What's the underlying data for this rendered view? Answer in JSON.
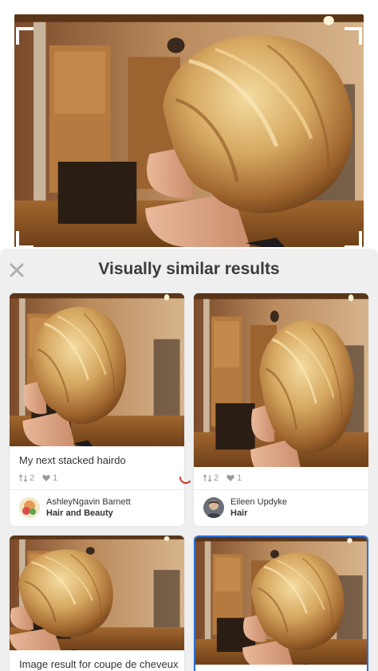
{
  "sheet": {
    "title": "Visually similar results",
    "close_icon": "close-icon"
  },
  "results": [
    {
      "description": "My next stacked hairdo",
      "repins": "2",
      "likes": "1",
      "pinner": "AshleyNgavin Barnett",
      "board": "Hair and Beauty"
    },
    {
      "description": "",
      "repins": "2",
      "likes": "1",
      "pinner": "Eileen Updyke",
      "board": "Hair"
    },
    {
      "description": "Image result for coupe de cheveux"
    },
    {
      "description": ""
    }
  ],
  "colors": {
    "sheet_bg": "#efefef",
    "title": "#3b3b3b",
    "meta": "#9a9a9a",
    "spinner": "#d0312d"
  }
}
